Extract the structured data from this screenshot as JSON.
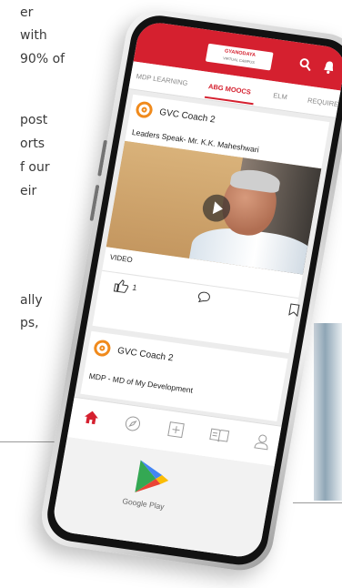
{
  "article_lines": [
    "er",
    "with",
    "90% of",
    "post",
    "orts",
    "f our",
    "eir",
    "ally",
    "ps,"
  ],
  "app": {
    "logo": {
      "title": "GYANODAYA",
      "subtitle": "VIRTUAL CAMPUS"
    },
    "header_icons": [
      "search-icon",
      "bell-icon"
    ],
    "tabs": [
      {
        "label": "MDP LEARNING"
      },
      {
        "label": "ABG MOOCS",
        "active": true
      },
      {
        "label": "ELM"
      },
      {
        "label": "REQUIRED"
      }
    ]
  },
  "posts": [
    {
      "author": "GVC Coach 2",
      "title": "Leaders Speak- Mr. K.K. Maheshwari",
      "media_label": "VIDEO",
      "likes": "1"
    },
    {
      "author": "GVC Coach 2",
      "title": "MDP - MD of My Development"
    }
  ],
  "bottom_nav": [
    "home-icon",
    "compass-icon",
    "plus-square-icon",
    "book-icon",
    "user-icon"
  ],
  "store_badge": {
    "label": "Google Play"
  },
  "colors": {
    "brand_red": "#d5202f",
    "logo_orange": "#f08a1c"
  }
}
